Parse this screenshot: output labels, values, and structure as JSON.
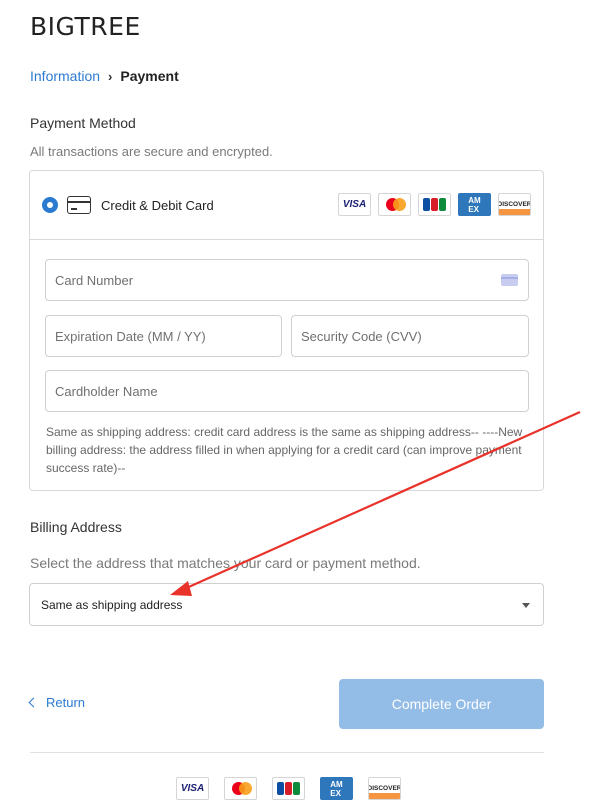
{
  "header": {
    "logo": "BIGTREE"
  },
  "breadcrumb": {
    "info": "Information",
    "separator": "›",
    "current": "Payment"
  },
  "payment": {
    "title": "Payment Method",
    "subtitle": "All transactions are secure and encrypted.",
    "method_label": "Credit & Debit Card",
    "brands": [
      "VISA",
      "MASTERCARD",
      "JCB",
      "AMEX",
      "DISCOVER"
    ],
    "fields": {
      "card_number": "Card Number",
      "expiration": "Expiration Date (MM / YY)",
      "security_code": "Security Code (CVV)",
      "cardholder": "Cardholder Name"
    },
    "note": "Same as shipping address: credit card address is the same as shipping address-- ----New billing address: the address filled in when applying for a credit card (can improve payment success rate)--"
  },
  "billing": {
    "title": "Billing Address",
    "subtitle": "Select the address that matches your card or payment method.",
    "selected": "Same as shipping address"
  },
  "actions": {
    "return_label": "Return",
    "complete_label": "Complete Order"
  },
  "colors": {
    "accent": "#2b7bd0",
    "button_disabled": "#93bde6",
    "annotation_arrow": "#e8322a"
  }
}
